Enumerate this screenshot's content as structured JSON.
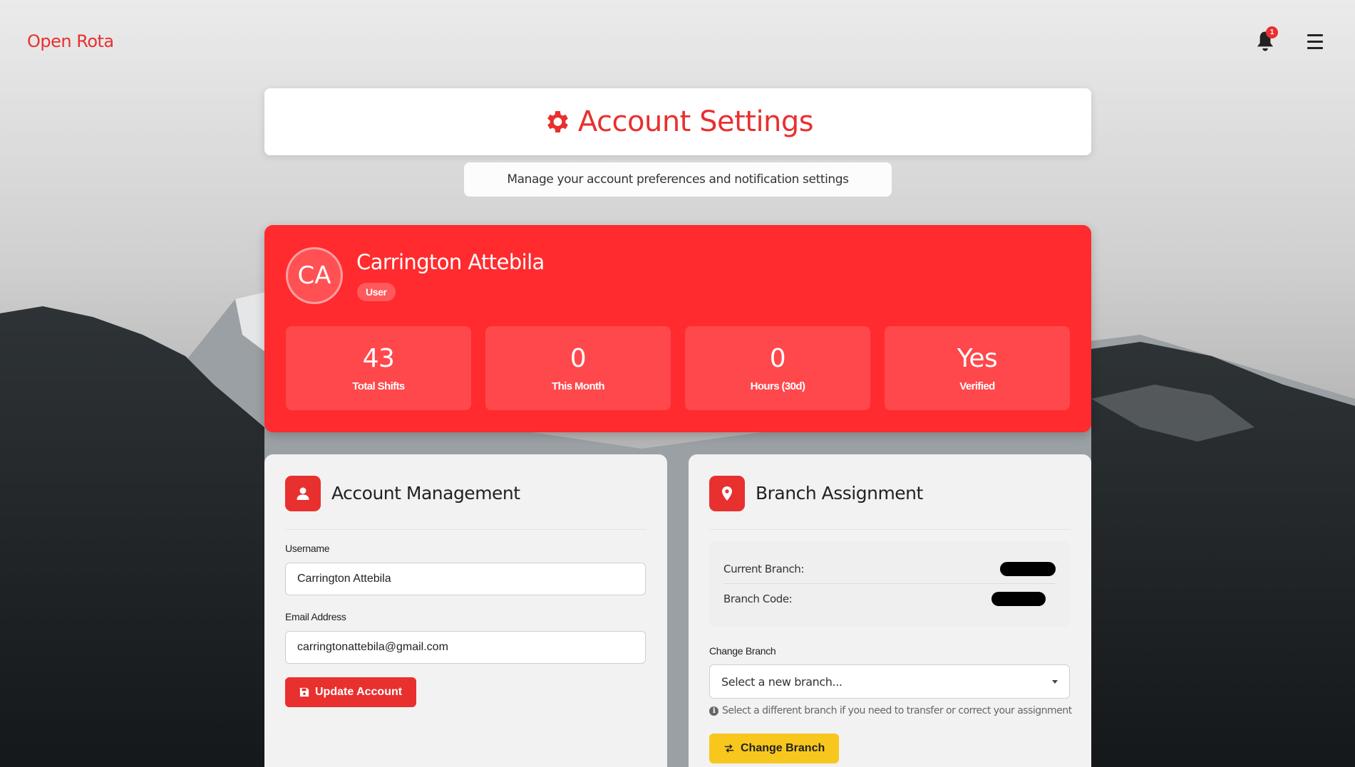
{
  "nav": {
    "brand": "Open Rota",
    "notification_count": "1",
    "bell_icon": "bell-icon",
    "menu_icon": "hamburger-menu-icon"
  },
  "header": {
    "title": "Account Settings",
    "title_icon": "gear-icon",
    "subtitle": "Manage your account preferences and notification settings"
  },
  "profile": {
    "initials": "CA",
    "name": "Carrington Attebila",
    "role": "User",
    "stats": [
      {
        "value": "43",
        "label": "Total Shifts"
      },
      {
        "value": "0",
        "label": "This Month"
      },
      {
        "value": "0",
        "label": "Hours (30d)"
      },
      {
        "value": "Yes",
        "label": "Verified"
      }
    ]
  },
  "account_management": {
    "title": "Account Management",
    "icon": "user-icon",
    "username_label": "Username",
    "username_value": "Carrington Attebila",
    "email_label": "Email Address",
    "email_value": "carringtonattebila@gmail.com",
    "update_button": "Update Account",
    "update_icon": "save-icon"
  },
  "branch_assignment": {
    "title": "Branch Assignment",
    "icon": "map-pin-icon",
    "current_branch_label": "Current Branch:",
    "branch_code_label": "Branch Code:",
    "change_branch_label": "Change Branch",
    "select_placeholder": "Select a new branch...",
    "help_text": "Select a different branch if you need to transfer or correct your assignment",
    "change_button": "Change Branch",
    "change_icon": "exchange-arrows-icon"
  },
  "colors": {
    "accent": "#e8302f",
    "profile_bg": "#ff2b2e",
    "warning": "#f8c71e"
  }
}
